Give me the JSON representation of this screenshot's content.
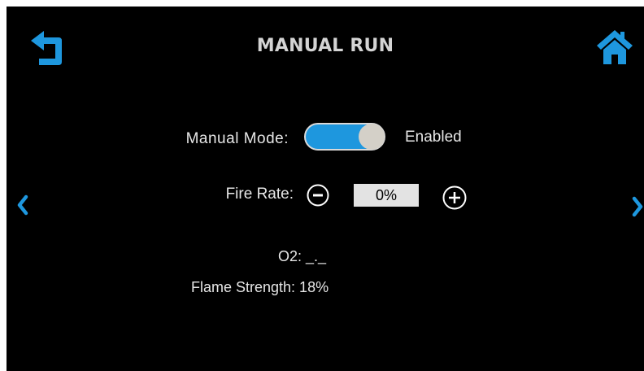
{
  "header": {
    "title": "MANUAL RUN",
    "back_icon": "back-arrow-icon",
    "home_icon": "home-icon"
  },
  "navigation": {
    "prev_icon": "chevron-left-icon",
    "next_icon": "chevron-right-icon"
  },
  "manual_mode": {
    "label": "Manual Mode:",
    "state": true,
    "status_text": "Enabled"
  },
  "fire_rate": {
    "label": "Fire Rate:",
    "value": "0%",
    "decrease_icon": "minus-circle-icon",
    "increase_icon": "plus-circle-icon"
  },
  "readings": {
    "o2": "O2: _._",
    "flame_strength": "Flame Strength: 18%"
  },
  "colors": {
    "background": "#000000",
    "accent": "#1e97de",
    "text": "#e6e6e6",
    "value_box": "#e3e3e3"
  }
}
